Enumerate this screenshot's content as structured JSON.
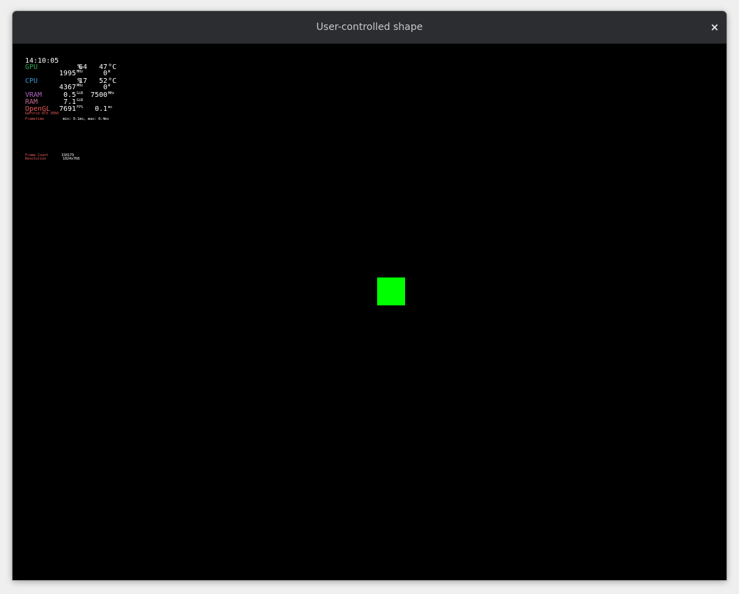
{
  "window": {
    "title": "User-controlled shape",
    "close_glyph": "×",
    "close_icon": "close-icon"
  },
  "overlay": {
    "time": "14:10:05",
    "gpu": {
      "label": "GPU",
      "load": "64",
      "load_unit": "%",
      "temp": "47",
      "temp_unit": "°C",
      "clock": "1995",
      "clock_unit": "MHz",
      "power": "0",
      "power_unit": "W"
    },
    "cpu": {
      "label": "CPU",
      "load": "17",
      "load_unit": "%",
      "temp": "52",
      "temp_unit": "°C",
      "clock": "4367",
      "clock_unit": "MHz",
      "power": "0",
      "power_unit": "W"
    },
    "vram": {
      "label": "VRAM",
      "used": "0.5",
      "used_unit": "GiB",
      "clock": "7500",
      "clock_unit": "MHz"
    },
    "ram": {
      "label": "RAM",
      "used": "7.1",
      "used_unit": "GiB"
    },
    "opengl": {
      "label": "OpenGL",
      "fps": "7691",
      "fps_unit": "FPS",
      "frametime": "0.1",
      "frametime_unit": "ms"
    },
    "gpu_name": "GeForce RTX 3060",
    "frametime": {
      "label": "Frametime",
      "value": "min: 0.1ms, max: 0.4ms"
    },
    "frame_count": {
      "label": "Frame Count",
      "value": "150179"
    },
    "resolution": {
      "label": "Resolution",
      "value": "1024x768"
    }
  },
  "shape": {
    "color": "#00ff00"
  },
  "colors": {
    "gpu": "#2ea64f",
    "cpu": "#2e97cb",
    "vram": "#ad64c1",
    "ram": "#c26693",
    "opengl": "#eb5b5b",
    "small_label": "#eb5b5b",
    "background": "#000000",
    "titlebar": "#2b2d31"
  }
}
